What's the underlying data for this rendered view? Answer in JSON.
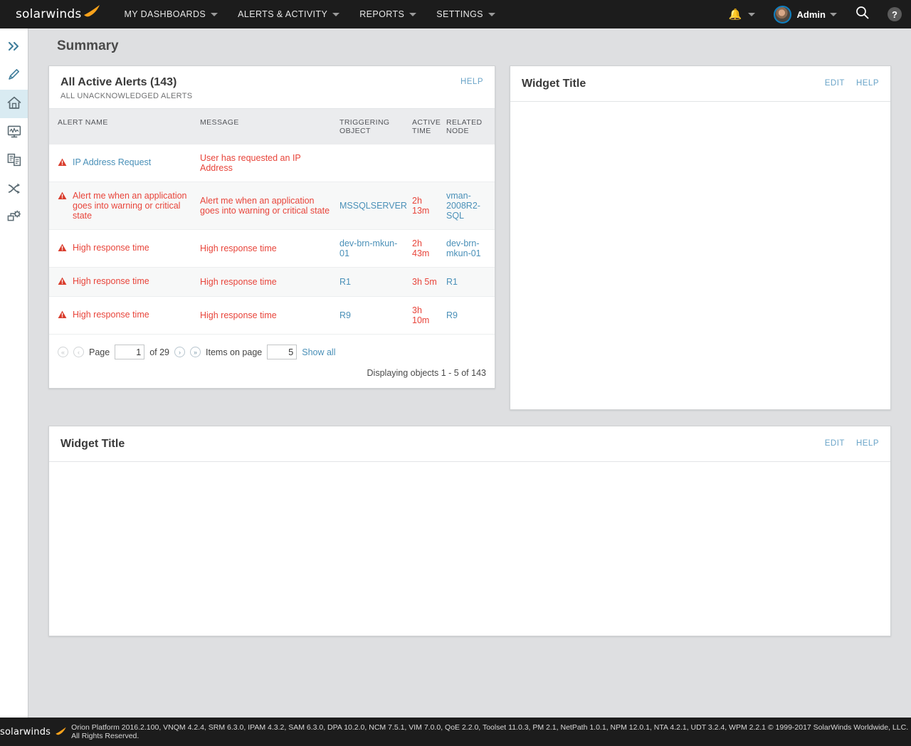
{
  "topnav": {
    "brand": "solarwinds",
    "brand_mark_icon": "swoosh-logo-icon",
    "items": [
      {
        "label": "MY DASHBOARDS",
        "caret_icon": "chevron-down-icon"
      },
      {
        "label": "ALERTS & ACTIVITY",
        "caret_icon": "chevron-down-icon"
      },
      {
        "label": "REPORTS",
        "caret_icon": "chevron-down-icon"
      },
      {
        "label": "SETTINGS",
        "caret_icon": "chevron-down-icon"
      }
    ],
    "bell_icon": "bell-icon",
    "bell_caret_icon": "chevron-down-icon",
    "avatar_icon": "user-avatar",
    "user_label": "Admin",
    "user_caret_icon": "chevron-down-icon",
    "search_icon": "search-icon",
    "help_icon": "question-mark-icon",
    "help_glyph": "?"
  },
  "sidebar": {
    "items": [
      {
        "icon": "double-chevron-right-icon",
        "name": "expand-menu"
      },
      {
        "icon": "pencil-icon",
        "name": "edit"
      },
      {
        "icon": "home-icon",
        "name": "home"
      },
      {
        "icon": "monitor-chart-icon",
        "name": "performance"
      },
      {
        "icon": "documents-icon",
        "name": "reports"
      },
      {
        "icon": "shuffle-arrows-icon",
        "name": "netpath"
      },
      {
        "icon": "device-gear-icon",
        "name": "settings"
      }
    ]
  },
  "page": {
    "title": "Summary"
  },
  "alerts_widget": {
    "title": "All Active Alerts (143)",
    "subtitle": "ALL UNACKNOWLEDGED ALERTS",
    "help_label": "HELP",
    "columns": [
      "ALERT NAME",
      "MESSAGE",
      "TRIGGERING OBJECT",
      "ACTIVE TIME",
      "RELATED NODE"
    ],
    "rows": [
      {
        "alert_icon": "alert-triangle-icon",
        "alert_name": "IP Address Request",
        "message": "User has requested an IP Address",
        "triggering_object": "",
        "active_time": "",
        "related_node": ""
      },
      {
        "alert_icon": "alert-triangle-icon",
        "alert_name": "Alert me when an application goes into warning or critical state",
        "message": "Alert me when an application goes into warning or critical state",
        "triggering_object": "MSSQLSERVER",
        "active_time": "2h 13m",
        "related_node": "vman-2008R2-SQL"
      },
      {
        "alert_icon": "alert-triangle-icon",
        "alert_name": "High response time",
        "message": "High response time",
        "triggering_object": "dev-brn-mkun-01",
        "active_time": "2h 43m",
        "related_node": "dev-brn-mkun-01"
      },
      {
        "alert_icon": "alert-triangle-icon",
        "alert_name": "High response time",
        "message": "High response time",
        "triggering_object": "R1",
        "active_time": "3h 5m",
        "related_node": "R1"
      },
      {
        "alert_icon": "alert-triangle-icon",
        "alert_name": "High response time",
        "message": "High response time",
        "triggering_object": "R9",
        "active_time": "3h 10m",
        "related_node": "R9"
      }
    ],
    "pager": {
      "first_glyph": "«",
      "prev_glyph": "‹",
      "next_glyph": "›",
      "last_glyph": "»",
      "page_label": "Page",
      "page_value": "1",
      "of_label": "of 29",
      "items_label": "Items on page",
      "items_value": "5",
      "show_all_label": "Show all",
      "displaying": "Displaying objects 1 - 5 of 143"
    }
  },
  "widget_right": {
    "title": "Widget Title",
    "edit_label": "EDIT",
    "help_label": "HELP"
  },
  "widget_bottom": {
    "title": "Widget Title",
    "edit_label": "EDIT",
    "help_label": "HELP"
  },
  "footer": {
    "brand": "solarwinds",
    "text": "Orion Platform 2016.2.100, VNQM 4.2.4, SRM 6.3.0, IPAM 4.3.2, SAM 6.3.0, DPA 10.2.0, NCM 7.5.1, VIM 7.0.0, QoE 2.2.0, Toolset 11.0.3, PM 2.1, NetPath 1.0.1, NPM 12.0.1, NTA 4.2.1, UDT 3.2.4, WPM 2.2.1 © 1999-2017 SolarWinds Worldwide, LLC. All Rights Reserved."
  },
  "colors": {
    "nav_bg": "#1c1c1c",
    "page_bg": "#dedfe1",
    "link": "#4a90b8",
    "alert_red": "#e8443a",
    "brand_orange": "#f9a21b",
    "active_sidebar": "#d9ebf2"
  }
}
